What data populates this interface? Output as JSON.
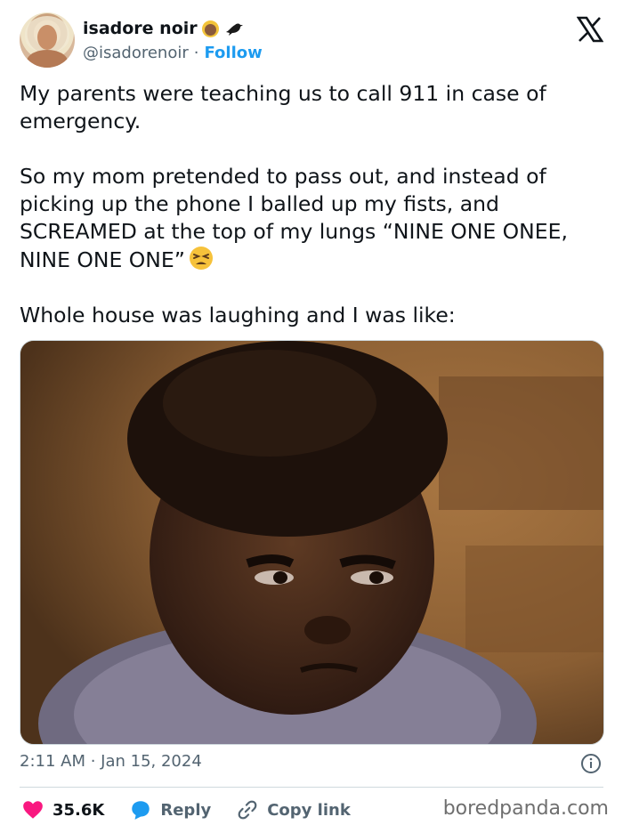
{
  "author": {
    "display_name": "isadore noir",
    "handle": "@isadorenoir",
    "separator": "·",
    "follow_label": "Follow"
  },
  "tweet": {
    "paragraph1": "My parents were teaching us to call 911 in case of emergency.",
    "paragraph2": "So my mom pretended to pass out, and instead of picking up the phone I balled up my fists, and SCREAMED at the top of my lungs “NINE ONE ONEE, NINE ONE ONE”",
    "paragraph3": "Whole house was laughing and I was like:",
    "timestamp": "2:11 AM · Jan 15, 2024"
  },
  "actions": {
    "likes": "35.6K",
    "reply_label": "Reply",
    "copy_link_label": "Copy link"
  },
  "watermark": "boredpanda.com",
  "icons": [
    "x-logo-icon",
    "heart-icon",
    "reply-icon",
    "link-icon",
    "info-icon",
    "tired-face-emoji",
    "bird-emoji",
    "person-emoji"
  ],
  "colors": {
    "accent": "#1d9bf0",
    "like": "#f91880",
    "muted": "#536471",
    "text": "#0f1419"
  }
}
